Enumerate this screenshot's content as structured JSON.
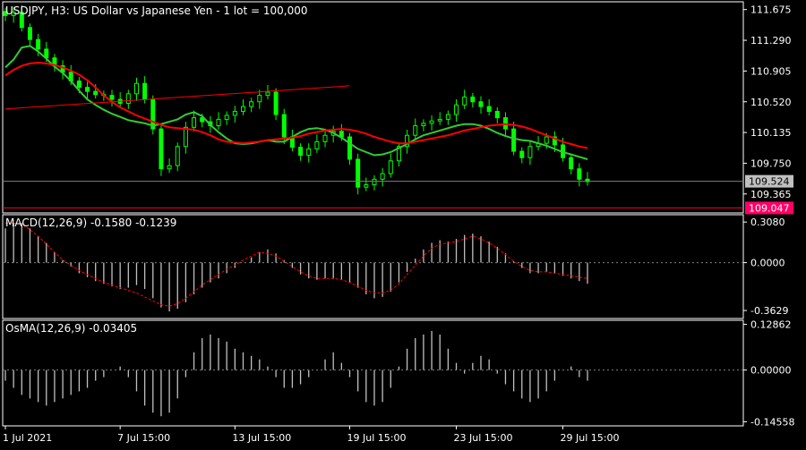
{
  "colors": {
    "background": "#000000",
    "frame": "#ffffff",
    "candle": "#00ff00",
    "ma_fast": "#32cd32",
    "ma_slow": "#ff0000",
    "trendline": "#ff0000",
    "hist": "#c0c0c0",
    "signal": "#ff0000",
    "bid_line": "#808080",
    "bid_label_bg": "#c0c0c0",
    "bid_label_text": "#000000",
    "level_line": "#ff0033",
    "level_label_bg": "#ff0066",
    "level_label_text": "#ffffff",
    "zero_line": "#808080"
  },
  "chart_data": [
    {
      "type": "candlestick",
      "panel": "main",
      "title": "USDJPY, H3:  US Dollar vs Japanese Yen - 1 lot = 100,000",
      "ylim": [
        109.15,
        111.75
      ],
      "y_ticks": [
        "111.675",
        "111.290",
        "110.905",
        "110.520",
        "110.135",
        "109.750",
        "109.365"
      ],
      "x_ticks": [
        "1 Jul 2021",
        "7 Jul 15:00",
        "13 Jul 15:00",
        "19 Jul 15:00",
        "23 Jul 15:00",
        "29 Jul 15:00"
      ],
      "bid_label": "109.524",
      "bid_price": 109.524,
      "level_label": "109.047",
      "level_price": 109.19,
      "close": [
        111.6,
        111.64,
        111.45,
        111.3,
        111.18,
        111.07,
        110.97,
        110.89,
        110.78,
        110.7,
        110.65,
        110.61,
        110.6,
        110.55,
        110.5,
        110.62,
        110.75,
        110.55,
        110.18,
        109.68,
        109.72,
        109.96,
        110.2,
        110.32,
        110.27,
        110.22,
        110.3,
        110.35,
        110.4,
        110.46,
        110.52,
        110.6,
        110.64,
        110.36,
        110.08,
        109.95,
        109.85,
        109.93,
        110.02,
        110.1,
        110.15,
        110.08,
        109.8,
        109.45,
        109.48,
        109.55,
        109.62,
        109.78,
        109.96,
        110.1,
        110.22,
        110.25,
        110.28,
        110.3,
        110.36,
        110.48,
        110.58,
        110.52,
        110.46,
        110.4,
        110.32,
        110.18,
        109.9,
        109.82,
        109.96,
        110.0,
        110.08,
        109.98,
        109.82,
        109.68,
        109.55,
        109.52
      ],
      "series": [
        {
          "name": "",
          "values": [
            110.95,
            111.05,
            111.2,
            111.22,
            111.15,
            111.06,
            110.96,
            110.88,
            110.78,
            110.66,
            110.55,
            110.48,
            110.42,
            110.37,
            110.33,
            110.29,
            110.27,
            110.25,
            110.22,
            110.24,
            110.27,
            110.3,
            110.36,
            110.39,
            110.34,
            110.23,
            110.14,
            110.06,
            110.0,
            109.99,
            110.0,
            110.02,
            110.04,
            110.02,
            110.02,
            110.08,
            110.14,
            110.18,
            110.19,
            110.17,
            110.13,
            110.07,
            110.0,
            109.93,
            109.89,
            109.85,
            109.86,
            109.89,
            109.94,
            109.99,
            110.05,
            110.1,
            110.13,
            110.16,
            110.19,
            110.22,
            110.24,
            110.24,
            110.22,
            110.18,
            110.13,
            110.09,
            110.06,
            110.04,
            110.03,
            110.0,
            109.97,
            109.93,
            109.89,
            109.86,
            109.83,
            109.8
          ]
        },
        {
          "name": "",
          "values": [
            110.85,
            110.92,
            110.97,
            111.0,
            111.01,
            111.0,
            110.98,
            110.95,
            110.91,
            110.86,
            110.79,
            110.7,
            110.6,
            110.52,
            110.45,
            110.4,
            110.35,
            110.31,
            110.27,
            110.23,
            110.2,
            110.19,
            110.18,
            110.17,
            110.14,
            110.1,
            110.05,
            110.02,
            110.01,
            110.0,
            110.01,
            110.02,
            110.04,
            110.05,
            110.06,
            110.07,
            110.09,
            110.12,
            110.14,
            110.16,
            110.17,
            110.18,
            110.17,
            110.15,
            110.12,
            110.08,
            110.05,
            110.02,
            110.0,
            110.0,
            110.02,
            110.04,
            110.06,
            110.08,
            110.1,
            110.13,
            110.16,
            110.18,
            110.2,
            110.22,
            110.23,
            110.24,
            110.23,
            110.21,
            110.18,
            110.14,
            110.1,
            110.06,
            110.02,
            109.99,
            109.96,
            109.94
          ]
        }
      ],
      "trendline": {
        "from": [
          0,
          110.43
        ],
        "to": [
          42,
          110.72
        ]
      }
    },
    {
      "type": "histogram+line",
      "panel": "macd",
      "label": "MACD(12,26,9) -0.1580 -0.1239",
      "ylim": [
        -0.41,
        0.35
      ],
      "y_ticks": [
        "0.3080",
        "0.0000",
        "-0.3629"
      ],
      "series": [
        {
          "name": "",
          "values": [
            0.26,
            0.3,
            0.3,
            0.26,
            0.2,
            0.15,
            0.08,
            0.02,
            -0.03,
            -0.08,
            -0.11,
            -0.14,
            -0.16,
            -0.18,
            -0.2,
            -0.19,
            -0.17,
            -0.2,
            -0.27,
            -0.34,
            -0.37,
            -0.35,
            -0.3,
            -0.24,
            -0.19,
            -0.15,
            -0.12,
            -0.08,
            -0.04,
            0.0,
            0.04,
            0.08,
            0.1,
            0.07,
            0.02,
            -0.04,
            -0.09,
            -0.12,
            -0.13,
            -0.12,
            -0.12,
            -0.13,
            -0.15,
            -0.19,
            -0.24,
            -0.27,
            -0.26,
            -0.22,
            -0.15,
            -0.07,
            0.03,
            0.1,
            0.15,
            0.17,
            0.16,
            0.18,
            0.21,
            0.22,
            0.2,
            0.16,
            0.12,
            0.07,
            0.01,
            -0.04,
            -0.08,
            -0.08,
            -0.07,
            -0.08,
            -0.1,
            -0.12,
            -0.14,
            -0.16
          ]
        },
        {
          "name": "",
          "values": [
            0.3,
            0.3,
            0.29,
            0.25,
            0.2,
            0.14,
            0.08,
            0.02,
            -0.02,
            -0.06,
            -0.09,
            -0.12,
            -0.15,
            -0.17,
            -0.19,
            -0.21,
            -0.23,
            -0.26,
            -0.29,
            -0.32,
            -0.33,
            -0.31,
            -0.27,
            -0.22,
            -0.17,
            -0.13,
            -0.09,
            -0.05,
            -0.02,
            0.02,
            0.05,
            0.08,
            0.07,
            0.05,
            0.01,
            -0.03,
            -0.07,
            -0.1,
            -0.12,
            -0.12,
            -0.12,
            -0.13,
            -0.15,
            -0.18,
            -0.21,
            -0.23,
            -0.23,
            -0.21,
            -0.16,
            -0.09,
            -0.02,
            0.05,
            0.11,
            0.14,
            0.15,
            0.16,
            0.18,
            0.2,
            0.18,
            0.15,
            0.11,
            0.06,
            0.01,
            -0.03,
            -0.06,
            -0.07,
            -0.07,
            -0.08,
            -0.09,
            -0.1,
            -0.11,
            -0.12
          ]
        }
      ]
    },
    {
      "type": "histogram",
      "panel": "osma",
      "label": "OsMA(12,26,9) -0.03405",
      "ylim": [
        -0.152,
        0.135
      ],
      "y_ticks": [
        "0.12862",
        "0.00000",
        "-0.14558"
      ],
      "x_ticks": [
        "1 Jul 2021",
        "7 Jul 15:00",
        "13 Jul 15:00",
        "19 Jul 15:00",
        "23 Jul 15:00",
        "29 Jul 15:00"
      ],
      "series": [
        {
          "name": "",
          "values": [
            -0.03,
            -0.05,
            -0.07,
            -0.08,
            -0.09,
            -0.1,
            -0.09,
            -0.08,
            -0.07,
            -0.06,
            -0.05,
            -0.03,
            -0.02,
            0.0,
            0.01,
            -0.02,
            -0.06,
            -0.1,
            -0.12,
            -0.13,
            -0.12,
            -0.08,
            -0.02,
            0.05,
            0.09,
            0.1,
            0.09,
            0.08,
            0.06,
            0.05,
            0.04,
            0.03,
            0.01,
            -0.02,
            -0.05,
            -0.05,
            -0.04,
            -0.02,
            0.0,
            0.03,
            0.05,
            0.02,
            -0.02,
            -0.06,
            -0.09,
            -0.1,
            -0.09,
            -0.05,
            0.01,
            0.06,
            0.09,
            0.1,
            0.11,
            0.1,
            0.06,
            0.02,
            -0.01,
            0.02,
            0.04,
            0.03,
            -0.01,
            -0.04,
            -0.06,
            -0.08,
            -0.09,
            -0.08,
            -0.06,
            -0.03,
            0.0,
            0.01,
            -0.02,
            -0.03
          ]
        }
      ]
    }
  ]
}
